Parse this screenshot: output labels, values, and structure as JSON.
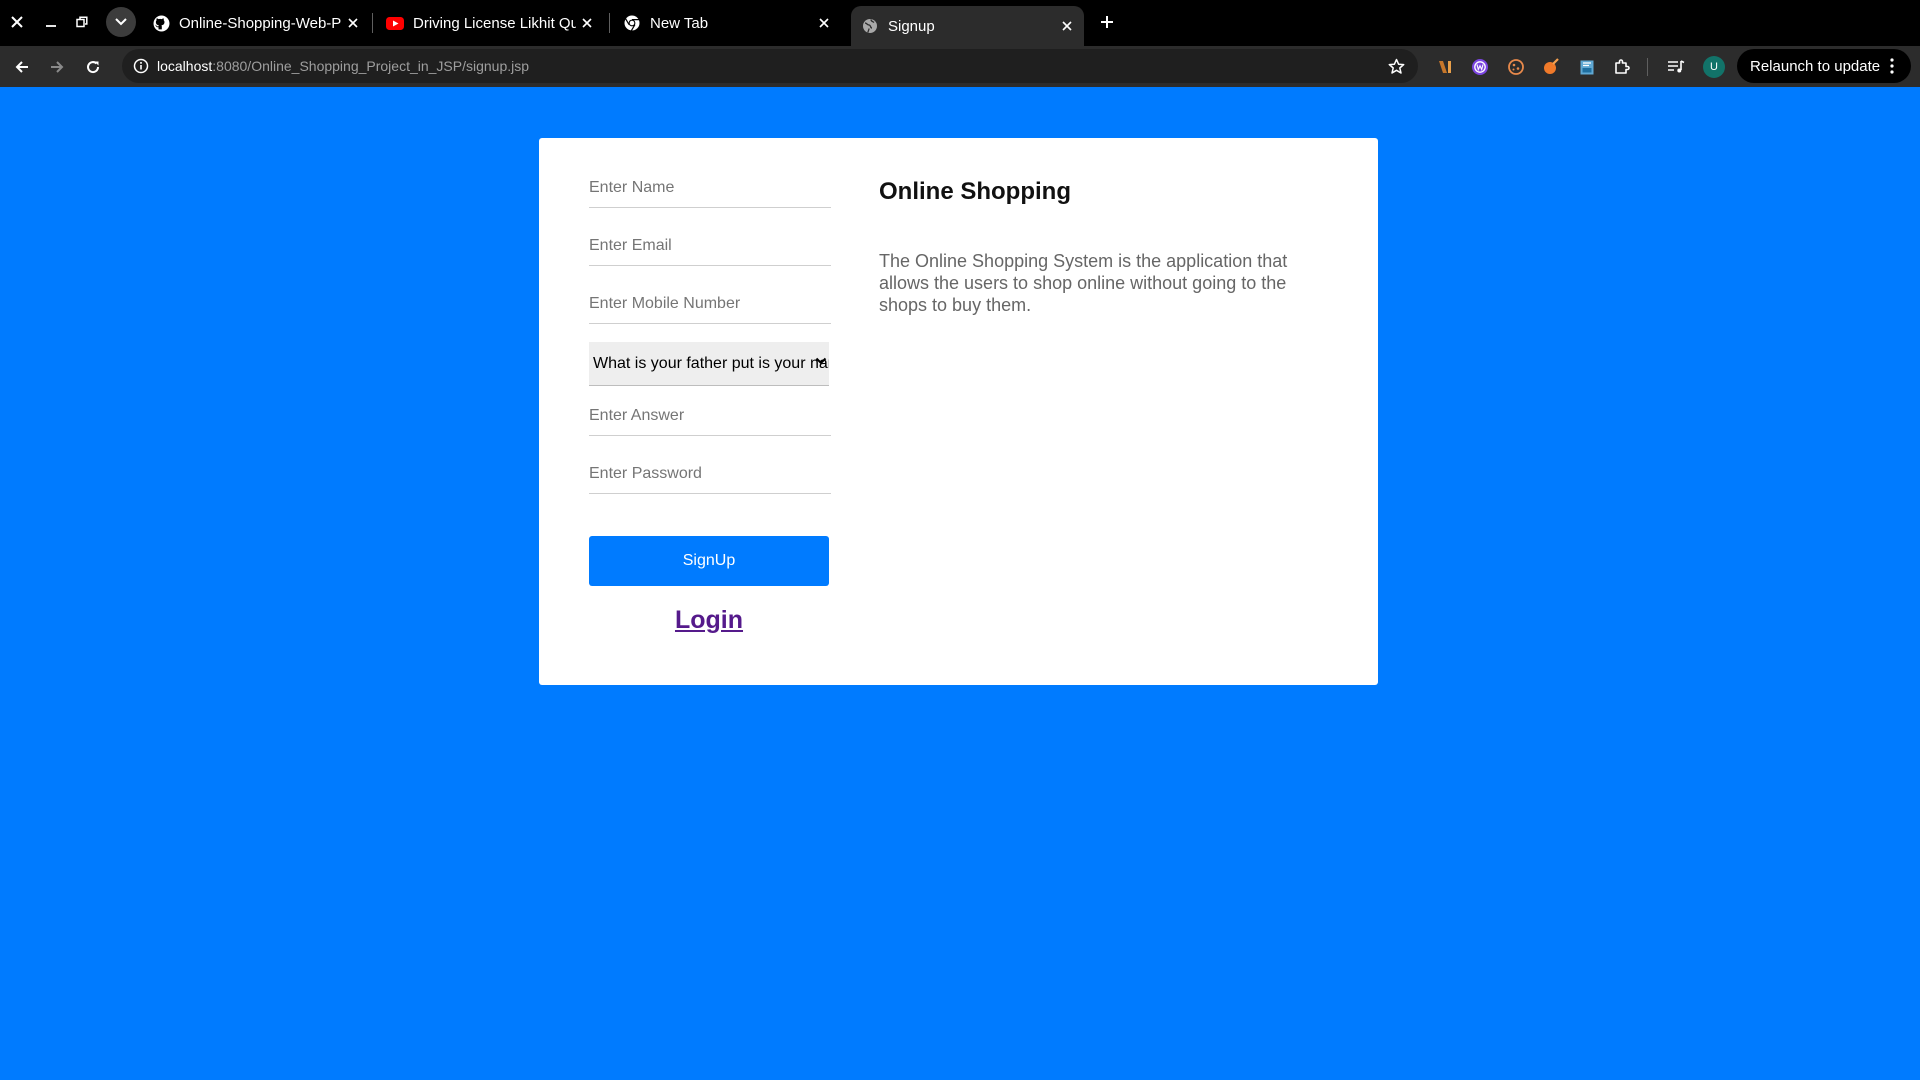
{
  "browser": {
    "tabs": [
      {
        "title": "Online-Shopping-Web-P",
        "icon": "github-icon"
      },
      {
        "title": "Driving License Likhit Qu",
        "icon": "youtube-icon"
      },
      {
        "title": "New Tab",
        "icon": "chrome-icon"
      },
      {
        "title": "Signup",
        "icon": "globe-icon",
        "active": true
      }
    ],
    "url_host": "localhost",
    "url_path": ":8080/Online_Shopping_Project_in_JSP/signup.jsp",
    "profile_initial": "U",
    "relaunch_label": "Relaunch to update"
  },
  "form": {
    "name_placeholder": "Enter Name",
    "email_placeholder": "Enter Email",
    "mobile_placeholder": "Enter Mobile Number",
    "security_question": "What is your father put is your name?",
    "answer_placeholder": "Enter Answer",
    "password_placeholder": "Enter Password",
    "signup_label": "SignUp",
    "login_label": "Login"
  },
  "info": {
    "title": "Online Shopping",
    "description": "The Online Shopping System is the application that allows the users to shop online without going to the shops to buy them."
  },
  "colors": {
    "page_background": "#007bff",
    "primary_button": "#007bff",
    "login_link": "#551a8b"
  }
}
